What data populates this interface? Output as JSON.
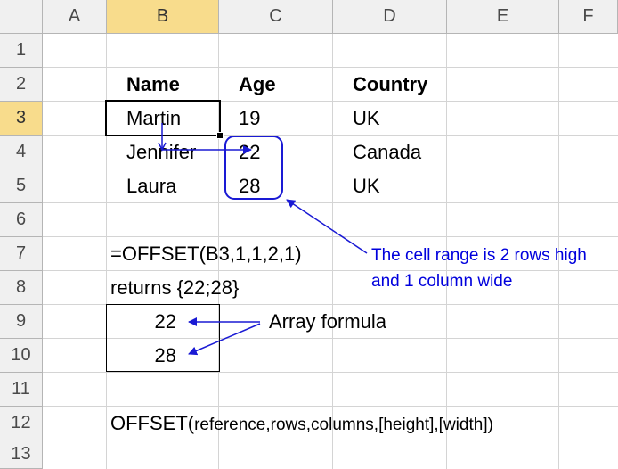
{
  "columns": [
    "A",
    "B",
    "C",
    "D",
    "E",
    "F"
  ],
  "rows": [
    "1",
    "2",
    "3",
    "4",
    "5",
    "6",
    "7",
    "8",
    "9",
    "10",
    "11",
    "12",
    "13"
  ],
  "selected": {
    "column": "B",
    "row": "3"
  },
  "table": {
    "headers": [
      "Name",
      "Age",
      "Country"
    ],
    "records": [
      {
        "name": "Martin",
        "age": "19",
        "country": "UK"
      },
      {
        "name": "Jennifer",
        "age": "22",
        "country": "Canada"
      },
      {
        "name": "Laura",
        "age": "28",
        "country": "UK"
      }
    ]
  },
  "formula": "=OFFSET(B3,1,1,2,1)",
  "returns": "returns  {22;28}",
  "results": [
    "22",
    "28"
  ],
  "annotations": {
    "range_note_line1": "The cell range is 2 rows high",
    "range_note_line2": "and 1 column wide",
    "array_formula": "Array formula"
  },
  "syntax": {
    "func": "OFFSET(",
    "args": "reference,rows,columns,[height],[width])"
  },
  "colors": {
    "arrow": "#1a1ad4",
    "annotation_text": "#0000dd",
    "header_selected": "#f8dc8c",
    "header_bg": "#f0f0f0"
  }
}
